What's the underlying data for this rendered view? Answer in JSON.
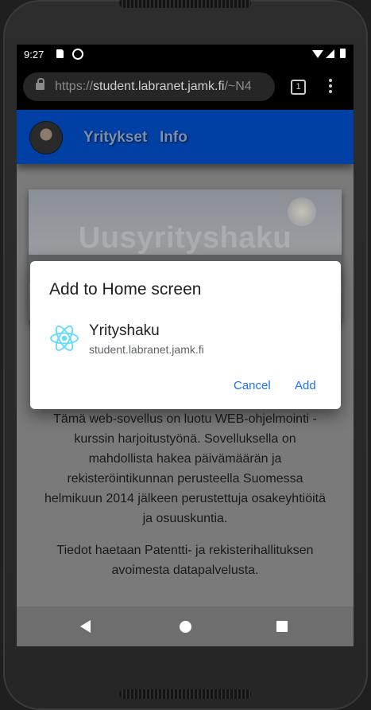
{
  "status_bar": {
    "time": "9:27"
  },
  "browser": {
    "url_scheme": "https://",
    "url_host": "student.labranet.jamk.fi",
    "url_path": "/~N4",
    "tab_count": "1"
  },
  "navbar": {
    "links": [
      "Yritykset",
      "Info"
    ]
  },
  "hero": {
    "title": "Uusyrityshaku"
  },
  "content": {
    "paragraph1": "Tämä web-sovellus on luotu WEB-ohjelmointi - kurssin harjoitustyönä. Sovelluksella on mahdollista hakea päivämäärän ja rekisteröintikunnan perusteella Suomessa helmikuun 2014 jälkeen perustettuja osakeyhtiöitä ja osuuskuntia.",
    "paragraph2": "Tiedot haetaan Patentti- ja rekisterihallituksen avoimesta datapalvelusta."
  },
  "dialog": {
    "title": "Add to Home screen",
    "app_name": "Yrityshaku",
    "app_url": "student.labranet.jamk.fi",
    "cancel_label": "Cancel",
    "add_label": "Add",
    "icon": "react-icon"
  },
  "colors": {
    "navbar": "#003fa3",
    "dialog_button": "#1a73e8"
  }
}
